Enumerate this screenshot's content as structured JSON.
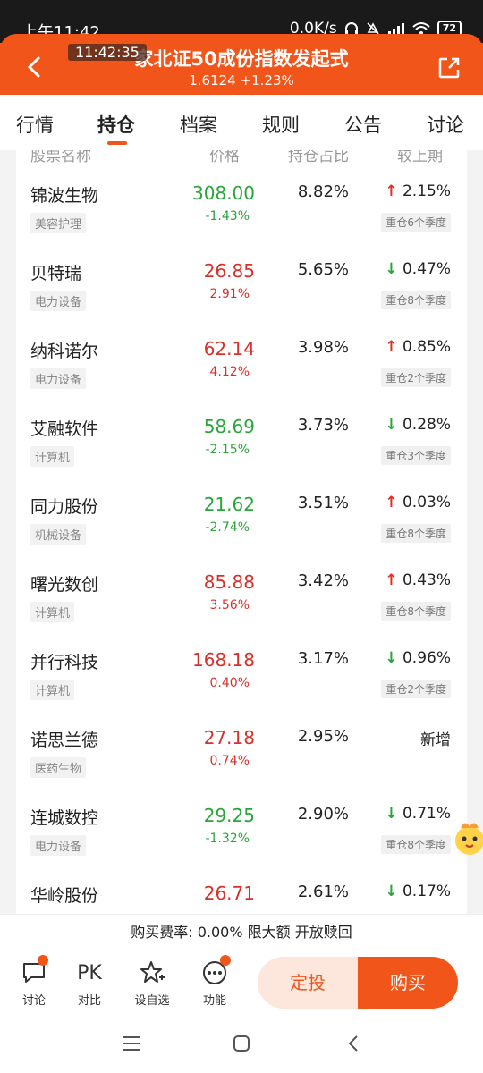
{
  "status_bar": {
    "time": "上午11:42",
    "speed": "0.0K/s",
    "battery": "72"
  },
  "header": {
    "clock_overlay": "11:42:35",
    "title": "家北证50成份指数发起式",
    "nav_value": "1.6124",
    "change": "+1.23%"
  },
  "tabs": [
    {
      "label": "行情"
    },
    {
      "label": "持仓"
    },
    {
      "label": "档案"
    },
    {
      "label": "规则"
    },
    {
      "label": "公告"
    },
    {
      "label": "讨论"
    }
  ],
  "columns": {
    "name": "股票名称",
    "price": "价格",
    "hold": "持仓占比",
    "delta": "较上期"
  },
  "holdings": [
    {
      "name": "锦波生物",
      "industry": "美容护理",
      "price": "308.00",
      "change": "-1.43%",
      "trend": "down",
      "hold": "8.82%",
      "delta_dir": "up",
      "delta": "2.15%",
      "season": "重仓6个季度"
    },
    {
      "name": "贝特瑞",
      "industry": "电力设备",
      "price": "26.85",
      "change": "2.91%",
      "trend": "up",
      "hold": "5.65%",
      "delta_dir": "down",
      "delta": "0.47%",
      "season": "重仓8个季度"
    },
    {
      "name": "纳科诺尔",
      "industry": "电力设备",
      "price": "62.14",
      "change": "4.12%",
      "trend": "up",
      "hold": "3.98%",
      "delta_dir": "up",
      "delta": "0.85%",
      "season": "重仓2个季度"
    },
    {
      "name": "艾融软件",
      "industry": "计算机",
      "price": "58.69",
      "change": "-2.15%",
      "trend": "down",
      "hold": "3.73%",
      "delta_dir": "down",
      "delta": "0.28%",
      "season": "重仓3个季度"
    },
    {
      "name": "同力股份",
      "industry": "机械设备",
      "price": "21.62",
      "change": "-2.74%",
      "trend": "down",
      "hold": "3.51%",
      "delta_dir": "up",
      "delta": "0.03%",
      "season": "重仓8个季度"
    },
    {
      "name": "曙光数创",
      "industry": "计算机",
      "price": "85.88",
      "change": "3.56%",
      "trend": "up",
      "hold": "3.42%",
      "delta_dir": "up",
      "delta": "0.43%",
      "season": "重仓8个季度"
    },
    {
      "name": "并行科技",
      "industry": "计算机",
      "price": "168.18",
      "change": "0.40%",
      "trend": "up",
      "hold": "3.17%",
      "delta_dir": "down",
      "delta": "0.96%",
      "season": "重仓2个季度"
    },
    {
      "name": "诺思兰德",
      "industry": "医药生物",
      "price": "27.18",
      "change": "0.74%",
      "trend": "up",
      "hold": "2.95%",
      "delta_dir": "new",
      "delta": "新增",
      "season": ""
    },
    {
      "name": "连城数控",
      "industry": "电力设备",
      "price": "29.25",
      "change": "-1.32%",
      "trend": "down",
      "hold": "2.90%",
      "delta_dir": "down",
      "delta": "0.71%",
      "season": "重仓8个季度"
    },
    {
      "name": "华岭股份",
      "industry": "",
      "price": "26.71",
      "change": "",
      "trend": "up",
      "hold": "2.61%",
      "delta_dir": "down",
      "delta": "0.17%",
      "season": ""
    }
  ],
  "fee_line": "购买费率: 0.00% 限大额 开放赎回",
  "actions": {
    "discuss": "讨论",
    "pk_icon": "PK",
    "compare": "对比",
    "watch": "设自选",
    "function": "功能",
    "auto_invest": "定投",
    "buy": "购买"
  },
  "colors": {
    "accent": "#f25519",
    "up": "#d9302a",
    "down": "#2aa53a"
  }
}
